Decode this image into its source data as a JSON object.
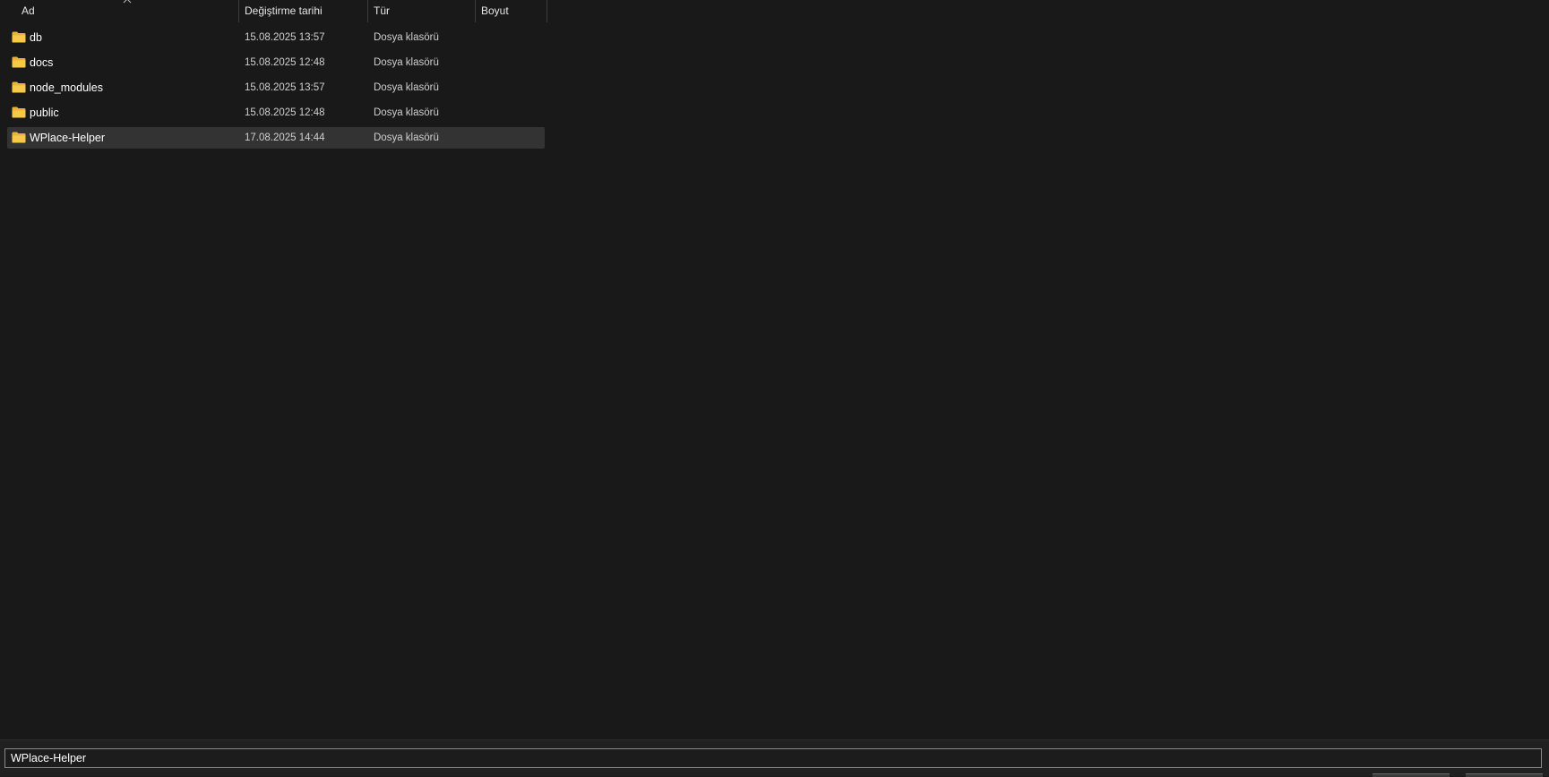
{
  "columns": {
    "name": "Ad",
    "date": "Değiştirme tarihi",
    "type": "Tür",
    "size": "Boyut"
  },
  "files": [
    {
      "name": "db",
      "date": "15.08.2025 13:57",
      "type": "Dosya klasörü",
      "icon": "folder-icon"
    },
    {
      "name": "docs",
      "date": "15.08.2025 12:48",
      "type": "Dosya klasörü",
      "icon": "folder-icon"
    },
    {
      "name": "node_modules",
      "date": "15.08.2025 13:57",
      "type": "Dosya klasörü",
      "icon": "folder-icon"
    },
    {
      "name": "public",
      "date": "15.08.2025 12:48",
      "type": "Dosya klasörü",
      "icon": "folder-icon"
    },
    {
      "name": "WPlace-Helper",
      "date": "17.08.2025 14:44",
      "type": "Dosya klasörü",
      "icon": "folder-icon",
      "selected": true
    }
  ],
  "filename": {
    "value": "WPlace-Helper"
  },
  "colors": {
    "background": "#191919",
    "selected_row": "#333333",
    "folder_yellow": "#f8c948"
  }
}
